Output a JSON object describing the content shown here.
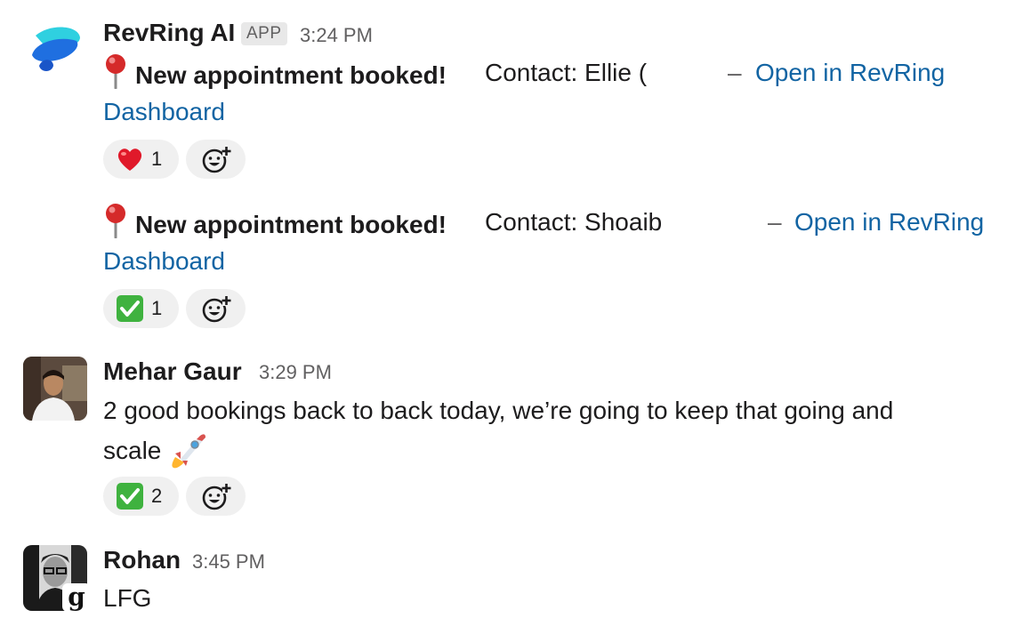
{
  "messages": [
    {
      "sender": "RevRing AI",
      "badge": "APP",
      "time": "3:24 PM",
      "lines": [
        {
          "title": "New appointment booked!",
          "contact_prefix": "Contact: Ellie (",
          "dash": "–",
          "link_line1": "Open in RevRing",
          "link_line2": "Dashboard",
          "reaction_count": "1",
          "reaction_icon": "red-heart"
        },
        {
          "title": "New appointment booked!",
          "contact_prefix": "Contact: Shoaib",
          "dash": "–",
          "link_line1": "Open in RevRing",
          "link_line2": "Dashboard",
          "reaction_count": "1",
          "reaction_icon": "check-mark-button"
        }
      ]
    },
    {
      "sender": "Mehar Gaur",
      "time": "3:29 PM",
      "text_line1": "2 good bookings back to back today, we’re going to keep that going and",
      "text_line2": "scale",
      "text_emoji": "rocket",
      "reaction_count": "2",
      "reaction_icon": "check-mark-button"
    },
    {
      "sender": "Rohan",
      "time": "3:45 PM",
      "text": "LFG",
      "avatar_badge": "g"
    }
  ],
  "colors": {
    "link": "#1264a3",
    "text": "#1d1c1d",
    "muted": "#616061",
    "reaction_bg": "#f0f0f0",
    "check_green": "#3fb23f",
    "heart_red": "#e0192a"
  }
}
